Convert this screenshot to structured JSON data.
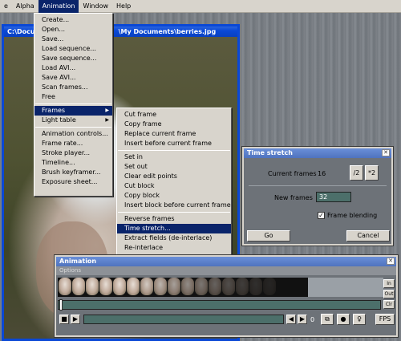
{
  "menubar": {
    "items": [
      "e",
      "Alpha",
      "Animation",
      "Window",
      "Help"
    ]
  },
  "image_window": {
    "title": "C:\\Doc… \\My Documents\\berries.jpg",
    "title_prefix": "C:\\Docu",
    "title_suffix": "\\My Documents\\berries.jpg"
  },
  "animation_menu": {
    "group1": [
      "Create...",
      "Open...",
      "Save...",
      "Load sequence...",
      "Save sequence...",
      "Load AVI...",
      "Save AVI...",
      "Scan frames...",
      "Free"
    ],
    "group2": [
      "Frames",
      "Light table"
    ],
    "group3": [
      "Animation controls...",
      "Frame rate...",
      "Stroke player...",
      "Timeline...",
      "Brush keyframer...",
      "Exposure sheet..."
    ]
  },
  "frames_menu": {
    "group1": [
      "Cut frame",
      "Copy frame",
      "Replace current frame",
      "Insert before current frame"
    ],
    "group2": [
      "Set in",
      "Set out",
      "Clear edit points",
      "Cut block",
      "Copy block",
      "Insert block before current frame"
    ],
    "group3": [
      "Reverse frames",
      "Time stretch...",
      "Extract fields (de-interlace)",
      "Re-interlace"
    ],
    "selected": "Time stretch..."
  },
  "time_stretch": {
    "title": "Time stretch",
    "current_frames_label": "Current frames",
    "current_frames_value": "16",
    "half_button": "/2",
    "double_button": "*2",
    "new_frames_label": "New frames",
    "new_frames_value": "32",
    "frame_blending_label": "Frame blending",
    "frame_blending_checked": true,
    "go_button": "Go",
    "cancel_button": "Cancel"
  },
  "animation_window": {
    "title": "Animation",
    "options_label": "Options",
    "in_button": "In",
    "out_button": "Out",
    "clr_button": "Clr",
    "frame_counter": "0",
    "fps_button": "FPS",
    "thumbnail_count": 16
  },
  "colors": {
    "xp_blue": "#0a48d6",
    "menu_highlight": "#0a246a",
    "menu_bg": "#d8d4cc",
    "panel_bg": "#6d7278"
  }
}
